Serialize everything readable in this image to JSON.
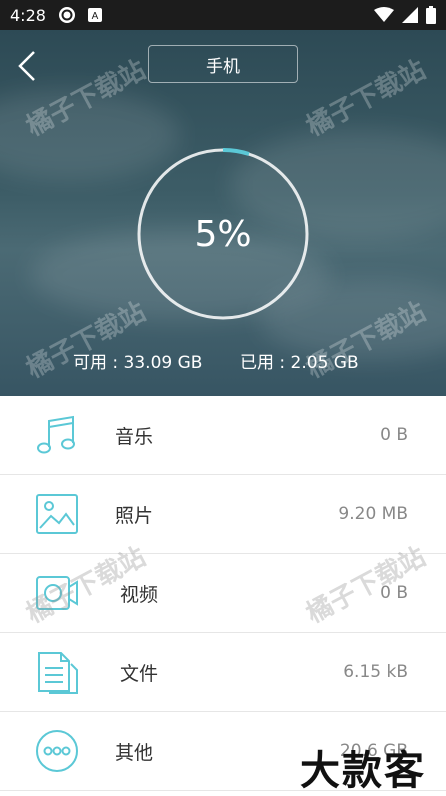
{
  "status_bar": {
    "time": "4:28"
  },
  "header": {
    "device": "手机",
    "percent": "5%",
    "available": "可用 : 33.09 GB",
    "used": "已用 : 2.05 GB"
  },
  "categories": [
    {
      "label": "音乐",
      "size": "0 B",
      "icon": "music-note-icon"
    },
    {
      "label": "照片",
      "size": "9.20 MB",
      "icon": "image-icon"
    },
    {
      "label": "视频",
      "size": "0 B",
      "icon": "video-icon"
    },
    {
      "label": "文件",
      "size": "6.15 kB",
      "icon": "document-icon"
    },
    {
      "label": "其他",
      "size": "20.6 GB",
      "icon": "more-icon"
    }
  ],
  "watermark": "橘子下载站",
  "brand": "大款客",
  "colors": {
    "accent": "#5bc8d6",
    "hero_bg": "#3d5d67"
  }
}
